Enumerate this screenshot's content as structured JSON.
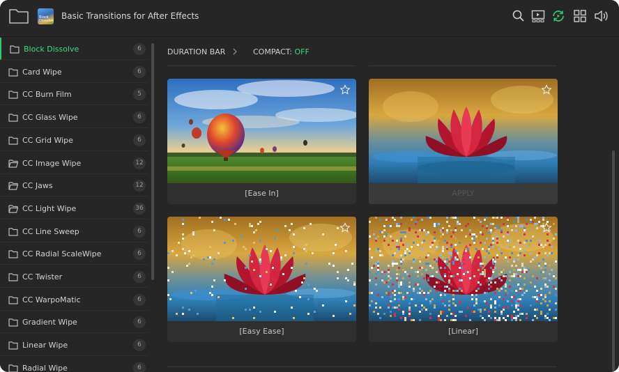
{
  "header": {
    "title": "Basic Transitions for After Effects",
    "thumb_text": "Block Dissolve",
    "icons": [
      "search-icon",
      "preview-window-icon",
      "sync-icon",
      "grid-view-icon",
      "volume-icon"
    ],
    "accent": "#2ecc71"
  },
  "sidebar": {
    "items": [
      {
        "label": "Block Dissolve",
        "count": "6",
        "active": true,
        "icon": "folder-icon"
      },
      {
        "label": "Card Wipe",
        "count": "6",
        "icon": "folder-icon"
      },
      {
        "label": "CC Burn Film",
        "count": "5",
        "icon": "folder-icon"
      },
      {
        "label": "CC Glass Wipe",
        "count": "6",
        "icon": "folder-icon"
      },
      {
        "label": "CC Grid Wipe",
        "count": "6",
        "icon": "folder-icon"
      },
      {
        "label": "CC Image Wipe",
        "count": "12",
        "icon": "folder-open-icon"
      },
      {
        "label": "CC Jaws",
        "count": "12",
        "icon": "folder-open-icon"
      },
      {
        "label": "CC Light Wipe",
        "count": "36",
        "icon": "folder-open-icon"
      },
      {
        "label": "CC Line Sweep",
        "count": "6",
        "icon": "folder-icon"
      },
      {
        "label": "CC Radial ScaleWipe",
        "count": "6",
        "icon": "folder-icon"
      },
      {
        "label": "CC Twister",
        "count": "6",
        "icon": "folder-icon"
      },
      {
        "label": "CC WarpoMatic",
        "count": "6",
        "icon": "folder-icon"
      },
      {
        "label": "Gradient Wipe",
        "count": "6",
        "icon": "folder-icon"
      },
      {
        "label": "Linear Wipe",
        "count": "6",
        "icon": "folder-icon"
      },
      {
        "label": "Radial Wipe",
        "count": "6",
        "icon": "folder-icon"
      }
    ]
  },
  "toolbar": {
    "duration_label": "DURATION BAR",
    "compact_label": "COMPACT:",
    "compact_value": "OFF"
  },
  "cards": [
    {
      "caption": "[Ease In]",
      "scene": "balloon"
    },
    {
      "caption": "APPLY",
      "scene": "lotus"
    },
    {
      "caption": "[Easy Ease]",
      "scene": "lotus-dissolve-light"
    },
    {
      "caption": "[Linear]",
      "scene": "lotus-dissolve-heavy"
    }
  ]
}
